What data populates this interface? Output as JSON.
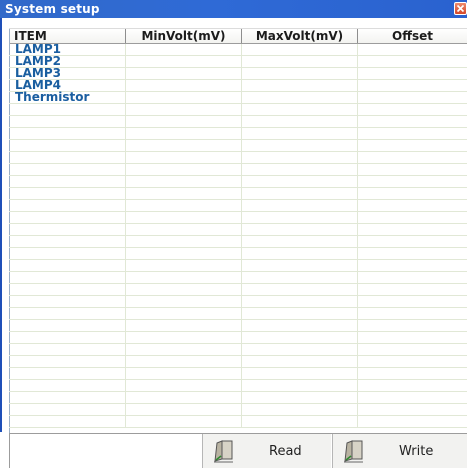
{
  "window": {
    "title": "System setup",
    "close_icon": "close-icon",
    "accent": "#2f6ad6"
  },
  "table": {
    "columns": [
      "ITEM",
      "MinVolt(mV)",
      "MaxVolt(mV)",
      "Offset"
    ],
    "rows": [
      [
        "LAMP1",
        "",
        "",
        ""
      ],
      [
        "LAMP2",
        "",
        "",
        ""
      ],
      [
        "LAMP3",
        "",
        "",
        ""
      ],
      [
        "LAMP4",
        "",
        "",
        ""
      ],
      [
        "Thermistor",
        "",
        "",
        ""
      ],
      [
        "",
        "",
        "",
        ""
      ],
      [
        "",
        "",
        "",
        ""
      ],
      [
        "",
        "",
        "",
        ""
      ],
      [
        "",
        "",
        "",
        ""
      ],
      [
        "",
        "",
        "",
        ""
      ],
      [
        "",
        "",
        "",
        ""
      ],
      [
        "",
        "",
        "",
        ""
      ],
      [
        "",
        "",
        "",
        ""
      ],
      [
        "",
        "",
        "",
        ""
      ],
      [
        "",
        "",
        "",
        ""
      ],
      [
        "",
        "",
        "",
        ""
      ],
      [
        "",
        "",
        "",
        ""
      ],
      [
        "",
        "",
        "",
        ""
      ],
      [
        "",
        "",
        "",
        ""
      ],
      [
        "",
        "",
        "",
        ""
      ],
      [
        "",
        "",
        "",
        ""
      ],
      [
        "",
        "",
        "",
        ""
      ],
      [
        "",
        "",
        "",
        ""
      ],
      [
        "",
        "",
        "",
        ""
      ],
      [
        "",
        "",
        "",
        ""
      ],
      [
        "",
        "",
        "",
        ""
      ],
      [
        "",
        "",
        "",
        ""
      ],
      [
        "",
        "",
        "",
        ""
      ],
      [
        "",
        "",
        "",
        ""
      ],
      [
        "",
        "",
        "",
        ""
      ],
      [
        "",
        "",
        "",
        ""
      ],
      [
        "",
        "",
        "",
        ""
      ]
    ],
    "item_color": "#1a5ea0"
  },
  "buttons": {
    "read": {
      "label": "Read",
      "icon": "door-icon"
    },
    "write": {
      "label": "Write",
      "icon": "door-icon"
    }
  }
}
